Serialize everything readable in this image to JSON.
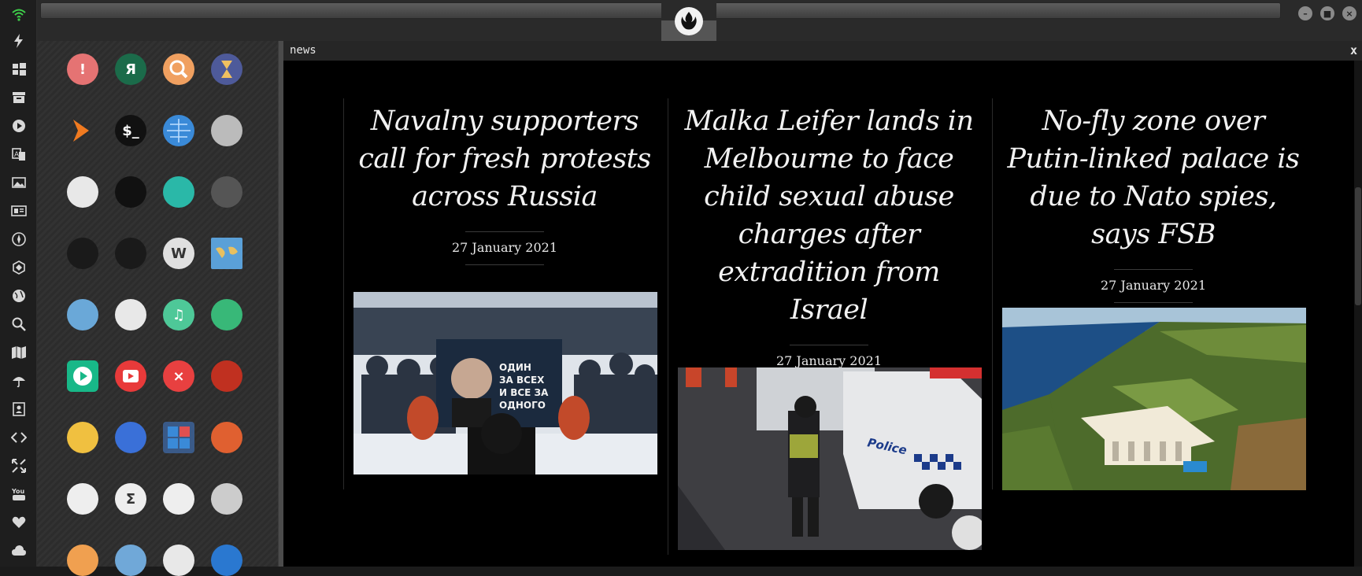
{
  "dock": {
    "items": [
      {
        "name": "wifi-icon"
      },
      {
        "name": "bolt-icon"
      },
      {
        "name": "windows-icon"
      },
      {
        "name": "archive-icon"
      },
      {
        "name": "play-icon"
      },
      {
        "name": "translate-icon"
      },
      {
        "name": "image-icon"
      },
      {
        "name": "news-icon"
      },
      {
        "name": "rebel-alliance-icon"
      },
      {
        "name": "hexagon-icon"
      },
      {
        "name": "globe-icon"
      },
      {
        "name": "search-icon"
      },
      {
        "name": "map-icon"
      },
      {
        "name": "umbrella-icon"
      },
      {
        "name": "contacts-icon"
      },
      {
        "name": "code-icon"
      },
      {
        "name": "expand-icon"
      },
      {
        "name": "youtube-icon"
      },
      {
        "name": "heart-icon"
      },
      {
        "name": "cloud-icon"
      }
    ]
  },
  "window": {
    "minimize_label": "–",
    "maximize_label": "■",
    "close_label": "×"
  },
  "news": {
    "title": "news",
    "close_label": "x",
    "articles": [
      {
        "headline": "Navalny supporters call for fresh protests across Russia",
        "date": "27 January 2021",
        "image_sign": "ОДИН ЗА ВСЕХ И ВСЕ ЗА ОДНОГО"
      },
      {
        "headline": "Malka Leifer lands in Melbourne to face child sexual abuse charges after extradition from Israel",
        "date": "27 January 2021",
        "image_sign": "Police"
      },
      {
        "headline": "No-fly zone over Putin-linked palace is due to Nato spies, says FSB",
        "date": "27 January 2021"
      }
    ]
  },
  "launcher": {
    "apps": [
      {
        "name": "warning-app-icon",
        "glyph": "!",
        "color": "#e57373"
      },
      {
        "name": "yandex-app-icon",
        "glyph": "Я",
        "color": "#1b6b4a"
      },
      {
        "name": "search-app-icon",
        "glyph": "",
        "color": "#f0a060"
      },
      {
        "name": "hourglass-app-icon",
        "glyph": "",
        "color": "#4e5a9a"
      },
      {
        "name": "terminal-arrow-app-icon",
        "glyph": "",
        "color": "#f07a20"
      },
      {
        "name": "shell-app-icon",
        "glyph": "$_",
        "color": "#111111"
      },
      {
        "name": "globe-app-icon",
        "glyph": "",
        "color": "#3a8ad8"
      },
      {
        "name": "drive-app-icon",
        "glyph": "",
        "color": "#bbbbbb"
      },
      {
        "name": "window-app-icon",
        "glyph": "",
        "color": "#e8e8e8"
      },
      {
        "name": "helmet-app-icon",
        "glyph": "",
        "color": "#111111"
      },
      {
        "name": "cloud-lock-app-icon",
        "glyph": "",
        "color": "#2ab8a8"
      },
      {
        "name": "github-app-icon",
        "glyph": "",
        "color": "#555555"
      },
      {
        "name": "starfleet-app-icon",
        "glyph": "",
        "color": "#1a1a1a"
      },
      {
        "name": "death-star-app-icon",
        "glyph": "",
        "color": "#1a1a1a"
      },
      {
        "name": "wikipedia-app-icon",
        "glyph": "W",
        "color": "#e0e0e0"
      },
      {
        "name": "world-map-app-icon",
        "glyph": "",
        "color": "#5aa0d8"
      },
      {
        "name": "books-app-icon",
        "glyph": "",
        "color": "#6aa8d8"
      },
      {
        "name": "notes-app-icon",
        "glyph": "",
        "color": "#e8e8e8"
      },
      {
        "name": "music-app-icon",
        "glyph": "♫",
        "color": "#4ec898"
      },
      {
        "name": "video-app-icon",
        "glyph": "",
        "color": "#38b878"
      },
      {
        "name": "player-app-icon",
        "glyph": "",
        "color": "#18b888"
      },
      {
        "name": "youtube-app-icon",
        "glyph": "",
        "color": "#e83a3a"
      },
      {
        "name": "close-circle-app-icon",
        "glyph": "×",
        "color": "#e84040"
      },
      {
        "name": "ironman-app-icon",
        "glyph": "",
        "color": "#c03020"
      },
      {
        "name": "droid-app-icon",
        "glyph": "",
        "color": "#f0c040"
      },
      {
        "name": "translator-app-icon",
        "glyph": "",
        "color": "#3a70d8"
      },
      {
        "name": "calculator-app-icon",
        "glyph": "",
        "color": "#3a5a88"
      },
      {
        "name": "color-picker-app-icon",
        "glyph": "",
        "color": "#e06030"
      },
      {
        "name": "lab-app-icon",
        "glyph": "",
        "color": "#eeeeee"
      },
      {
        "name": "sigma-app-icon",
        "glyph": "Σ",
        "color": "#eeeeee"
      },
      {
        "name": "binary-app-icon",
        "glyph": "",
        "color": "#eeeeee"
      },
      {
        "name": "text-editor-app-icon",
        "glyph": "",
        "color": "#cccccc"
      },
      {
        "name": "document-app-icon",
        "glyph": "",
        "color": "#f0a050"
      },
      {
        "name": "photo-app-icon",
        "glyph": "",
        "color": "#70a8d8"
      },
      {
        "name": "presentation-app-icon",
        "glyph": "",
        "color": "#e8e8e8"
      },
      {
        "name": "vscode-app-icon",
        "glyph": "",
        "color": "#2a78d0"
      }
    ]
  }
}
